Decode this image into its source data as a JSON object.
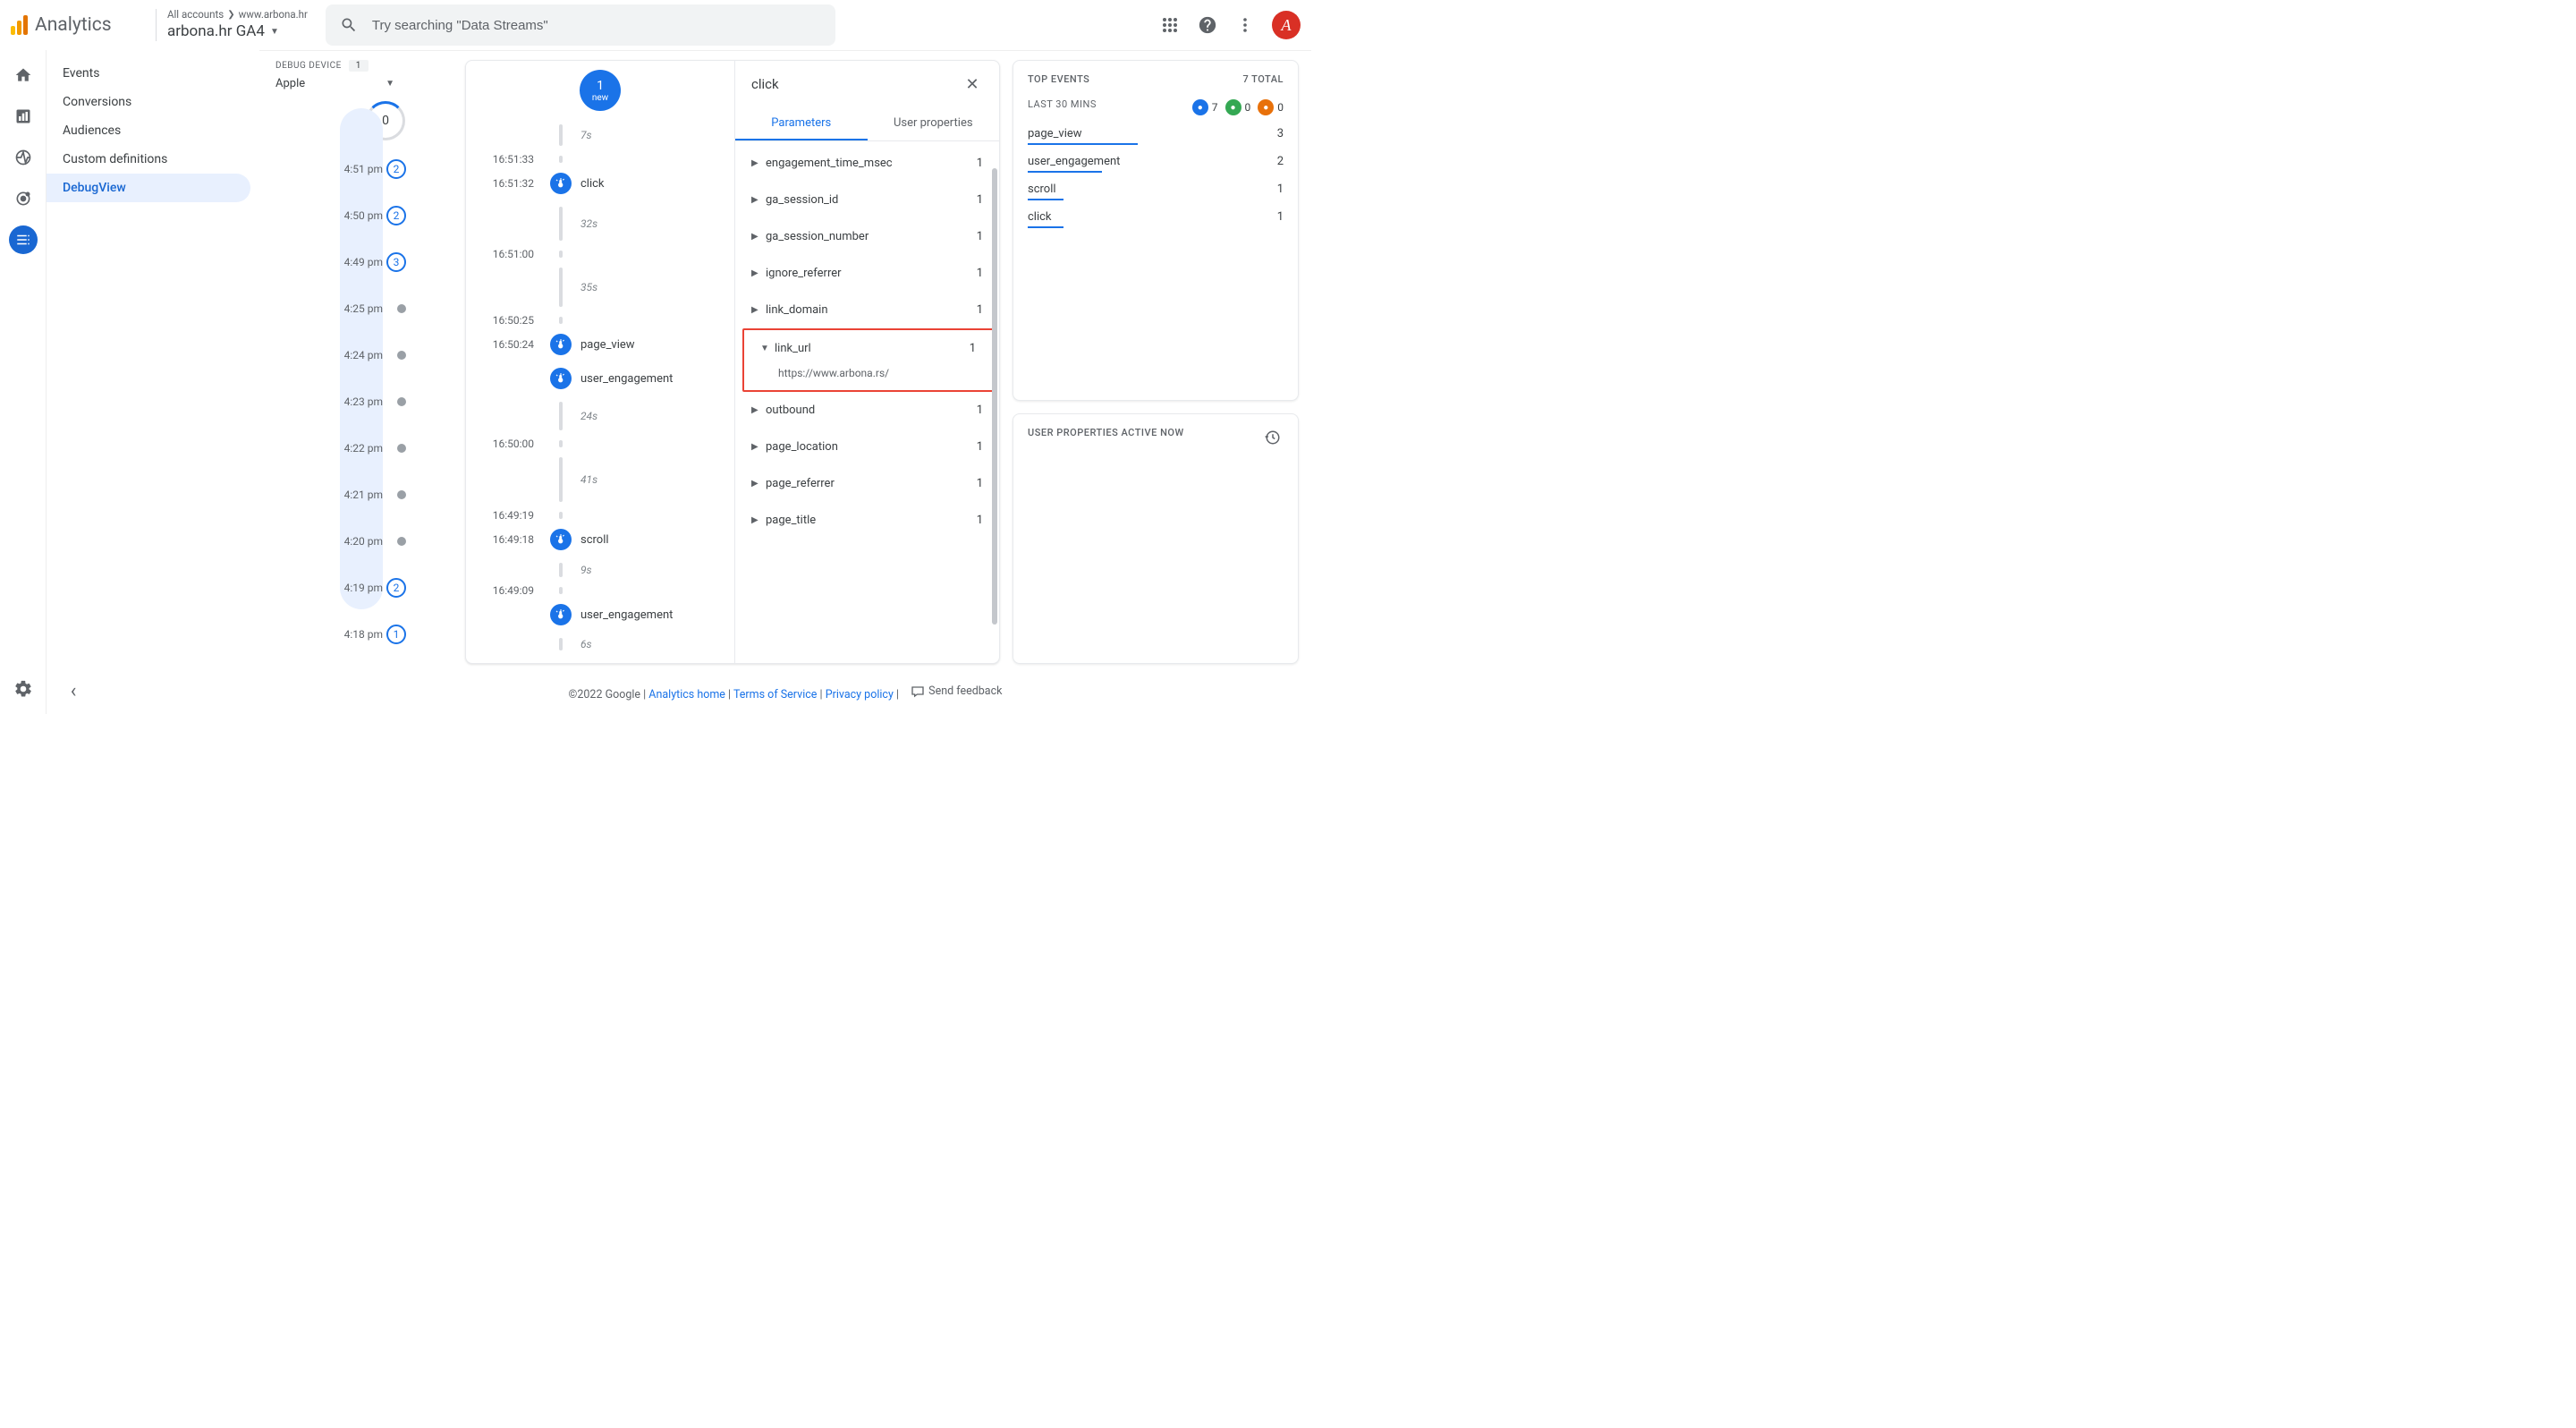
{
  "header": {
    "analytics": "Analytics",
    "breadcrumb_all": "All accounts",
    "breadcrumb_site": "www.arbona.hr",
    "property": "arbona.hr GA4",
    "search_placeholder": "Try searching \"Data Streams\"",
    "avatar_initial": "A"
  },
  "sidenav": {
    "items": [
      "Events",
      "Conversions",
      "Audiences",
      "Custom definitions",
      "DebugView"
    ],
    "active_index": 4
  },
  "minutes": {
    "debug_label": "DEBUG DEVICE",
    "debug_count": "1",
    "device": "Apple",
    "big_zero": "0",
    "rows": [
      {
        "time": "4:51 pm",
        "count": "2",
        "blue": true
      },
      {
        "time": "4:50 pm",
        "count": "2",
        "blue": true
      },
      {
        "time": "4:49 pm",
        "count": "3",
        "blue": true
      },
      {
        "time": "4:25 pm",
        "count": "",
        "blue": false
      },
      {
        "time": "4:24 pm",
        "count": "",
        "blue": false
      },
      {
        "time": "4:23 pm",
        "count": "",
        "blue": false
      },
      {
        "time": "4:22 pm",
        "count": "",
        "blue": false
      },
      {
        "time": "4:21 pm",
        "count": "",
        "blue": false
      },
      {
        "time": "4:20 pm",
        "count": "",
        "blue": false
      },
      {
        "time": "4:19 pm",
        "count": "2",
        "blue": true
      },
      {
        "time": "4:18 pm",
        "count": "1",
        "blue": true
      }
    ]
  },
  "timeline": {
    "bubble_num": "1",
    "bubble_sub": "new",
    "rows": [
      {
        "type": "gap",
        "label": "7s",
        "h": 24
      },
      {
        "type": "time",
        "time": "16:51:33",
        "h": 8
      },
      {
        "type": "event",
        "time": "16:51:32",
        "label": "click"
      },
      {
        "type": "gap",
        "label": "32s",
        "h": 38
      },
      {
        "type": "time",
        "time": "16:51:00",
        "h": 8
      },
      {
        "type": "gap",
        "label": "35s",
        "h": 44
      },
      {
        "type": "time",
        "time": "16:50:25",
        "h": 8
      },
      {
        "type": "event",
        "time": "16:50:24",
        "label": "page_view"
      },
      {
        "type": "event",
        "time": "",
        "label": "user_engagement"
      },
      {
        "type": "gap",
        "label": "24s",
        "h": 32
      },
      {
        "type": "time",
        "time": "16:50:00",
        "h": 8
      },
      {
        "type": "gap",
        "label": "41s",
        "h": 50
      },
      {
        "type": "time",
        "time": "16:49:19",
        "h": 8
      },
      {
        "type": "event",
        "time": "16:49:18",
        "label": "scroll"
      },
      {
        "type": "gap",
        "label": "9s",
        "h": 16
      },
      {
        "type": "time",
        "time": "16:49:09",
        "h": 8
      },
      {
        "type": "event",
        "time": "",
        "label": "user_engagement"
      },
      {
        "type": "gap",
        "label": "6s",
        "h": 14
      }
    ]
  },
  "detail": {
    "title": "click",
    "tabs": [
      "Parameters",
      "User properties"
    ],
    "params": [
      {
        "name": "engagement_time_msec",
        "count": "1"
      },
      {
        "name": "ga_session_id",
        "count": "1"
      },
      {
        "name": "ga_session_number",
        "count": "1"
      },
      {
        "name": "ignore_referrer",
        "count": "1"
      },
      {
        "name": "link_domain",
        "count": "1"
      },
      {
        "name": "link_url",
        "count": "1",
        "expanded": true,
        "value": "https://www.arbona.rs/"
      },
      {
        "name": "outbound",
        "count": "1"
      },
      {
        "name": "page_location",
        "count": "1"
      },
      {
        "name": "page_referrer",
        "count": "1"
      },
      {
        "name": "page_title",
        "count": "1"
      }
    ]
  },
  "topevents": {
    "title": "TOP EVENTS",
    "total": "7 TOTAL",
    "last30": "LAST 30 MINS",
    "pills": [
      {
        "class": "p-blue",
        "val": "7"
      },
      {
        "class": "p-green",
        "val": "0"
      },
      {
        "class": "p-orange",
        "val": "0"
      }
    ],
    "rows": [
      {
        "name": "page_view",
        "count": "3",
        "pct": 43
      },
      {
        "name": "user_engagement",
        "count": "2",
        "pct": 29
      },
      {
        "name": "scroll",
        "count": "1",
        "pct": 14
      },
      {
        "name": "click",
        "count": "1",
        "pct": 14
      }
    ]
  },
  "userprops": {
    "title": "USER PROPERTIES ACTIVE NOW"
  },
  "footer": {
    "copyright": "©2022 Google",
    "links": [
      "Analytics home",
      "Terms of Service",
      "Privacy policy"
    ],
    "feedback": "Send feedback"
  }
}
